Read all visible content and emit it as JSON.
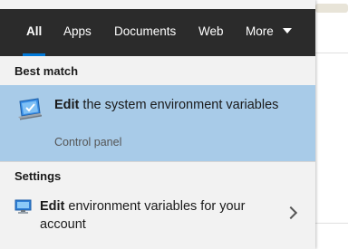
{
  "tabs": [
    {
      "label": "All",
      "active": true
    },
    {
      "label": "Apps",
      "active": false
    },
    {
      "label": "Documents",
      "active": false
    },
    {
      "label": "Web",
      "active": false
    },
    {
      "label": "More",
      "active": false
    }
  ],
  "best_match": {
    "section_label": "Best match",
    "title_bold": "Edit",
    "title_rest": " the system environment variables",
    "subtitle": "Control panel",
    "icon": "monitor-checkmark-icon"
  },
  "settings": {
    "section_label": "Settings",
    "items": [
      {
        "title_bold": "Edit",
        "title_rest": " environment variables for your account",
        "icon": "monitor-settings-icon"
      }
    ]
  },
  "colors": {
    "tabbar_bg": "#2b2b2b",
    "accent": "#0078d7",
    "selected_bg": "#a8cbe8",
    "panel_bg": "#f2f2f2"
  }
}
